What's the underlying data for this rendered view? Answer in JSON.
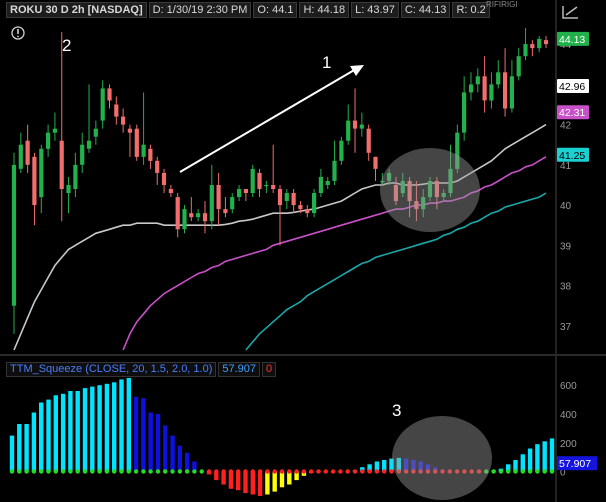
{
  "header": {
    "symbol": "ROKU 30 D 2h [NASDAQ]",
    "date": "D: 1/30/19 2:30 PM",
    "open": "O: 44.1",
    "high": "H: 44.18",
    "low": "L: 43.97",
    "close": "C: 44.13",
    "range": "R: 0.2",
    "top_right_text": "RIFIRIGI"
  },
  "annotations": {
    "label_1": "1",
    "label_2": "2",
    "label_3": "3"
  },
  "price_badges": {
    "last": "44.13",
    "white": "42.96",
    "magenta": "42.31",
    "cyan": "41.25"
  },
  "indicator": {
    "name": "TTM_Squeeze (CLOSE, 20, 1.5, 2.0, 1.0)",
    "value": "57.907",
    "flag": "0",
    "badge": "57.907"
  },
  "colors": {
    "up": "#22b14c",
    "down": "#f26d6d",
    "ma_white": "#c8c8c8",
    "ma_magenta": "#c850c8",
    "ma_cyan": "#1aa8a8",
    "hist_cyan": "#00e5ff",
    "hist_blue": "#1010dd",
    "hist_red": "#ff2020",
    "hist_yellow": "#ffff00",
    "dot_green": "#22dd22",
    "dot_red": "#ff2020"
  },
  "chart_data": [
    {
      "type": "candlestick",
      "ylim": [
        36.3,
        44.6
      ],
      "y_ticks": [
        37,
        38,
        39,
        40,
        41,
        42,
        43,
        44
      ],
      "candles": [
        [
          37.5,
          41.0,
          36.8,
          41.3
        ],
        [
          40.9,
          41.5,
          40.8,
          41.8
        ],
        [
          41.6,
          41.0,
          40.8,
          42.0
        ],
        [
          41.2,
          40.0,
          39.5,
          41.3
        ],
        [
          40.2,
          41.4,
          39.8,
          41.5
        ],
        [
          41.4,
          41.8,
          41.2,
          42.0
        ],
        [
          41.8,
          41.9,
          41.6,
          42.3
        ],
        [
          41.6,
          40.4,
          39.6,
          44.3
        ],
        [
          40.3,
          40.5,
          39.8,
          40.7
        ],
        [
          40.4,
          41.0,
          40.2,
          41.3
        ],
        [
          41.0,
          41.5,
          40.8,
          41.8
        ],
        [
          41.4,
          41.6,
          41.3,
          43.0
        ],
        [
          41.7,
          41.9,
          41.5,
          42.1
        ],
        [
          42.1,
          42.9,
          41.9,
          43.1
        ],
        [
          42.9,
          42.6,
          42.4,
          43.0
        ],
        [
          42.5,
          42.2,
          42.0,
          42.7
        ],
        [
          42.2,
          42.0,
          41.8,
          42.4
        ],
        [
          41.9,
          41.8,
          41.2,
          42.0
        ],
        [
          41.9,
          41.2,
          41.1,
          42.0
        ],
        [
          41.2,
          41.5,
          41.0,
          42.8
        ],
        [
          41.4,
          41.1,
          40.9,
          41.5
        ],
        [
          41.1,
          40.8,
          40.5,
          41.2
        ],
        [
          40.8,
          40.5,
          40.3,
          40.9
        ],
        [
          40.4,
          40.3,
          40.2,
          40.5
        ],
        [
          40.2,
          39.4,
          39.2,
          40.3
        ],
        [
          39.4,
          39.9,
          39.3,
          40.0
        ],
        [
          39.8,
          39.7,
          39.6,
          40.2
        ],
        [
          39.7,
          39.8,
          39.6,
          39.9
        ],
        [
          39.8,
          39.6,
          39.3,
          40.1
        ],
        [
          39.6,
          40.5,
          39.4,
          41.0
        ],
        [
          40.5,
          39.9,
          39.5,
          40.8
        ],
        [
          39.9,
          39.8,
          39.7,
          40.2
        ],
        [
          39.9,
          40.2,
          39.8,
          40.3
        ],
        [
          40.2,
          40.4,
          40.1,
          40.5
        ],
        [
          40.4,
          40.3,
          40.1,
          40.4
        ],
        [
          40.3,
          40.9,
          40.2,
          41.0
        ],
        [
          40.8,
          40.4,
          40.2,
          40.9
        ],
        [
          40.5,
          40.5,
          40.3,
          40.6
        ],
        [
          40.5,
          40.4,
          40.3,
          41.5
        ],
        [
          40.4,
          40.0,
          39.0,
          40.5
        ],
        [
          40.1,
          40.3,
          39.9,
          40.4
        ],
        [
          40.3,
          40.0,
          39.8,
          40.4
        ],
        [
          40.0,
          39.9,
          39.8,
          40.1
        ],
        [
          39.9,
          39.8,
          39.7,
          40.0
        ],
        [
          39.8,
          40.3,
          39.7,
          40.4
        ],
        [
          40.3,
          40.7,
          40.2,
          40.9
        ],
        [
          40.5,
          40.6,
          40.4,
          40.7
        ],
        [
          40.6,
          41.1,
          40.5,
          41.6
        ],
        [
          41.1,
          41.6,
          41.0,
          41.7
        ],
        [
          41.6,
          42.1,
          41.5,
          42.5
        ],
        [
          42.1,
          41.9,
          41.3,
          42.9
        ],
        [
          41.9,
          42.0,
          41.7,
          42.3
        ],
        [
          41.9,
          41.3,
          41.1,
          42.0
        ],
        [
          41.2,
          40.9,
          40.6,
          41.2
        ],
        [
          40.6,
          40.6,
          40.5,
          40.8
        ],
        [
          40.6,
          40.8,
          40.5,
          40.9
        ],
        [
          40.5,
          40.1,
          40.0,
          40.7
        ],
        [
          40.3,
          40.6,
          40.2,
          40.8
        ],
        [
          40.6,
          40.1,
          39.7,
          40.7
        ],
        [
          40.1,
          39.9,
          39.6,
          40.6
        ],
        [
          39.9,
          40.2,
          39.7,
          40.4
        ],
        [
          40.2,
          40.6,
          40.1,
          40.7
        ],
        [
          40.6,
          40.2,
          39.9,
          40.7
        ],
        [
          40.2,
          40.3,
          40.1,
          40.4
        ],
        [
          40.3,
          40.9,
          40.2,
          41.5
        ],
        [
          40.9,
          41.8,
          40.8,
          42.0
        ],
        [
          41.8,
          42.8,
          41.6,
          43.2
        ],
        [
          42.8,
          43.0,
          42.6,
          43.3
        ],
        [
          43.0,
          43.2,
          42.8,
          43.4
        ],
        [
          43.2,
          42.6,
          42.3,
          43.7
        ],
        [
          42.6,
          43.0,
          42.4,
          43.3
        ],
        [
          43.0,
          43.3,
          42.9,
          43.6
        ],
        [
          43.3,
          42.4,
          42.2,
          43.9
        ],
        [
          42.4,
          43.2,
          42.3,
          43.6
        ],
        [
          43.2,
          43.7,
          43.1,
          43.9
        ],
        [
          43.7,
          44.0,
          43.6,
          44.4
        ],
        [
          44.0,
          43.9,
          43.7,
          44.1
        ],
        [
          43.9,
          44.13,
          43.8,
          44.2
        ],
        [
          44.1,
          44.0,
          43.9,
          44.2
        ]
      ],
      "ma_white": [
        36.4,
        36.8,
        37.2,
        37.6,
        37.9,
        38.2,
        38.5,
        38.7,
        38.9,
        39.0,
        39.1,
        39.2,
        39.3,
        39.35,
        39.4,
        39.45,
        39.5,
        39.5,
        39.55,
        39.55,
        39.55,
        39.55,
        39.5,
        39.5,
        39.5,
        39.5,
        39.5,
        39.5,
        39.5,
        39.5,
        39.5,
        39.52,
        39.55,
        39.6,
        39.62,
        39.65,
        39.7,
        39.75,
        39.8,
        39.8,
        39.8,
        39.82,
        39.85,
        39.88,
        39.9,
        39.95,
        40.0,
        40.05,
        40.1,
        40.2,
        40.3,
        40.4,
        40.45,
        40.5,
        40.5,
        40.55,
        40.55,
        40.5,
        40.5,
        40.5,
        40.52,
        40.55,
        40.55,
        40.55,
        40.55,
        40.6,
        40.7,
        40.8,
        40.9,
        41.0,
        41.1,
        41.25,
        41.4,
        41.5,
        41.6,
        41.7,
        41.8,
        41.9,
        42.0
      ],
      "ma_magenta": [
        null,
        null,
        null,
        null,
        null,
        null,
        null,
        null,
        null,
        null,
        null,
        null,
        null,
        null,
        null,
        null,
        36.4,
        36.8,
        37.1,
        37.3,
        37.5,
        37.65,
        37.8,
        37.9,
        38.0,
        38.1,
        38.2,
        38.3,
        38.35,
        38.45,
        38.5,
        38.6,
        38.65,
        38.7,
        38.75,
        38.8,
        38.85,
        38.9,
        39.0,
        39.05,
        39.1,
        39.15,
        39.2,
        39.25,
        39.3,
        39.35,
        39.4,
        39.45,
        39.5,
        39.55,
        39.6,
        39.65,
        39.7,
        39.75,
        39.8,
        39.85,
        39.9,
        39.9,
        39.95,
        40.0,
        40.0,
        40.05,
        40.05,
        40.1,
        40.1,
        40.15,
        40.2,
        40.3,
        40.35,
        40.45,
        40.5,
        40.6,
        40.7,
        40.8,
        40.85,
        40.95,
        41.0,
        41.1,
        41.2
      ],
      "ma_cyan": [
        null,
        null,
        null,
        null,
        null,
        null,
        null,
        null,
        null,
        null,
        null,
        null,
        null,
        null,
        null,
        null,
        null,
        null,
        null,
        null,
        null,
        null,
        null,
        null,
        null,
        null,
        null,
        null,
        null,
        null,
        null,
        null,
        null,
        null,
        36.4,
        36.6,
        36.8,
        36.95,
        37.1,
        37.25,
        37.4,
        37.5,
        37.6,
        37.75,
        37.85,
        37.95,
        38.05,
        38.15,
        38.25,
        38.35,
        38.45,
        38.55,
        38.6,
        38.7,
        38.75,
        38.8,
        38.85,
        38.9,
        38.95,
        39.0,
        39.05,
        39.1,
        39.15,
        39.25,
        39.3,
        39.4,
        39.45,
        39.55,
        39.6,
        39.7,
        39.8,
        39.85,
        39.95,
        40.0,
        40.05,
        40.1,
        40.15,
        40.2,
        40.3
      ]
    },
    {
      "type": "bar",
      "title": "TTM_Squeeze (CLOSE, 20, 1.5, 2.0, 1.0)",
      "ylim": [
        -170,
        650
      ],
      "y_ticks": [
        0,
        200,
        400,
        600
      ],
      "values": [
        250,
        330,
        330,
        410,
        480,
        500,
        530,
        540,
        560,
        560,
        580,
        590,
        600,
        610,
        620,
        640,
        650,
        520,
        510,
        410,
        400,
        320,
        250,
        180,
        130,
        70,
        10,
        -20,
        -60,
        -90,
        -120,
        -130,
        -150,
        -160,
        -170,
        -160,
        -140,
        -110,
        -90,
        -60,
        -30,
        -10,
        -5,
        -3,
        -2,
        -1,
        0,
        10,
        30,
        50,
        70,
        80,
        90,
        95,
        90,
        80,
        70,
        50,
        30,
        10,
        0,
        -2,
        -3,
        -5,
        -3,
        0,
        10,
        20,
        50,
        80,
        120,
        160,
        190,
        210,
        230
      ],
      "bar_colors": [
        "cyan",
        "cyan",
        "cyan",
        "cyan",
        "cyan",
        "cyan",
        "cyan",
        "cyan",
        "cyan",
        "cyan",
        "cyan",
        "cyan",
        "cyan",
        "cyan",
        "cyan",
        "cyan",
        "cyan",
        "blue",
        "blue",
        "blue",
        "blue",
        "blue",
        "blue",
        "blue",
        "blue",
        "blue",
        "blue",
        "red",
        "red",
        "red",
        "red",
        "red",
        "red",
        "red",
        "red",
        "yellow",
        "yellow",
        "yellow",
        "yellow",
        "yellow",
        "yellow",
        "yellow",
        "yellow",
        "yellow",
        "yellow",
        "yellow",
        "yellow",
        "cyan",
        "cyan",
        "cyan",
        "cyan",
        "cyan",
        "cyan",
        "cyan",
        "blue",
        "blue",
        "blue",
        "blue",
        "blue",
        "blue",
        "red",
        "red",
        "red",
        "red",
        "red",
        "yellow",
        "cyan",
        "cyan",
        "cyan",
        "cyan",
        "cyan",
        "cyan",
        "cyan",
        "cyan",
        "cyan"
      ],
      "dot_colors": [
        "green",
        "green",
        "green",
        "green",
        "green",
        "green",
        "green",
        "green",
        "green",
        "green",
        "green",
        "green",
        "green",
        "green",
        "green",
        "green",
        "green",
        "green",
        "green",
        "green",
        "green",
        "green",
        "green",
        "green",
        "green",
        "green",
        "green",
        "red",
        "red",
        "red",
        "red",
        "red",
        "red",
        "red",
        "red",
        "red",
        "red",
        "red",
        "red",
        "red",
        "red",
        "red",
        "red",
        "red",
        "red",
        "red",
        "red",
        "red",
        "red",
        "red",
        "red",
        "red",
        "red",
        "red",
        "red",
        "red",
        "red",
        "red",
        "red",
        "red",
        "red",
        "red",
        "red",
        "red",
        "red",
        "green",
        "green",
        "green",
        "green",
        "green",
        "green",
        "green",
        "green",
        "green",
        "green"
      ]
    }
  ]
}
